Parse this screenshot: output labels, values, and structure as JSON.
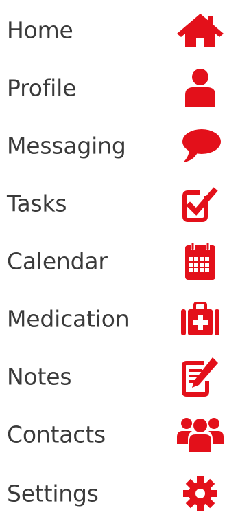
{
  "colors": {
    "accent": "#e3101a",
    "text": "#3a3a3a",
    "background": "#ffffff"
  },
  "menu": {
    "items": [
      {
        "label": "Home",
        "icon": "home-icon"
      },
      {
        "label": "Profile",
        "icon": "user-icon"
      },
      {
        "label": "Messaging",
        "icon": "speech-bubble-icon"
      },
      {
        "label": "Tasks",
        "icon": "checkbox-icon"
      },
      {
        "label": "Calendar",
        "icon": "calendar-icon"
      },
      {
        "label": "Medication",
        "icon": "medical-kit-icon"
      },
      {
        "label": "Notes",
        "icon": "edit-note-icon"
      },
      {
        "label": "Contacts",
        "icon": "users-icon"
      },
      {
        "label": "Settings",
        "icon": "gear-icon"
      }
    ]
  }
}
